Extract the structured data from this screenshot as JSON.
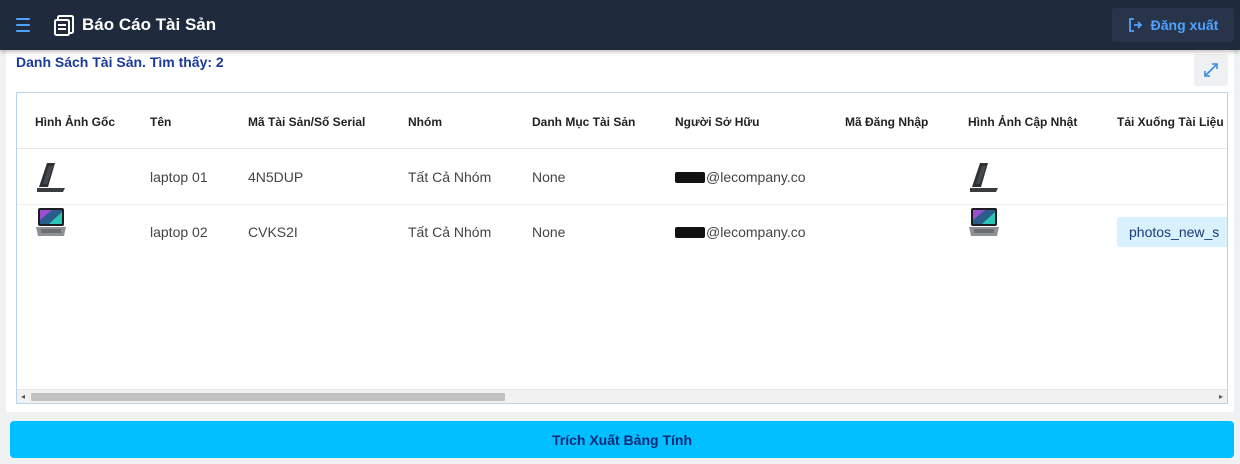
{
  "header": {
    "title": "Báo Cáo Tài Sản",
    "logout_label": "Đăng xuất",
    "menu_icon": "hamburger-icon",
    "report_icon": "report-icon",
    "logout_icon": "logout-icon"
  },
  "panel": {
    "list_title": "Danh Sách Tài Sản. Tìm thấy: 2",
    "expand_icon": "expand-icon"
  },
  "table": {
    "columns": [
      "Hình Ảnh Gốc",
      "Tên",
      "Mã Tài Sản/Số Serial",
      "Nhóm",
      "Danh Mục Tài Sản",
      "Người Sở Hữu",
      "Mã Đăng Nhập",
      "Hình Ảnh Cập Nhật",
      "Tải Xuống Tài Liệu"
    ],
    "rows": [
      {
        "original_image": "laptop-side-icon",
        "name": "laptop 01",
        "serial": "4N5DUP",
        "group": "Tất Cả Nhóm",
        "category": "None",
        "owner": "@lecompany.co",
        "login_code": "",
        "updated_image": "laptop-side-icon",
        "document": ""
      },
      {
        "original_image": "laptop-open-icon",
        "name": "laptop 02",
        "serial": "CVKS2I",
        "group": "Tất Cả Nhóm",
        "category": "None",
        "owner": "@lecompany.co",
        "login_code": "",
        "updated_image": "laptop-open-icon",
        "document": "photos_new_s"
      }
    ]
  },
  "footer": {
    "export_label": "Trích Xuất Bảng Tính"
  },
  "colors": {
    "topbar": "#1f2a3d",
    "accent_blue": "#4fa3ff",
    "title_blue": "#1a3a9a",
    "export_button": "#00bfff",
    "doc_chip": "#d8f1fc"
  }
}
